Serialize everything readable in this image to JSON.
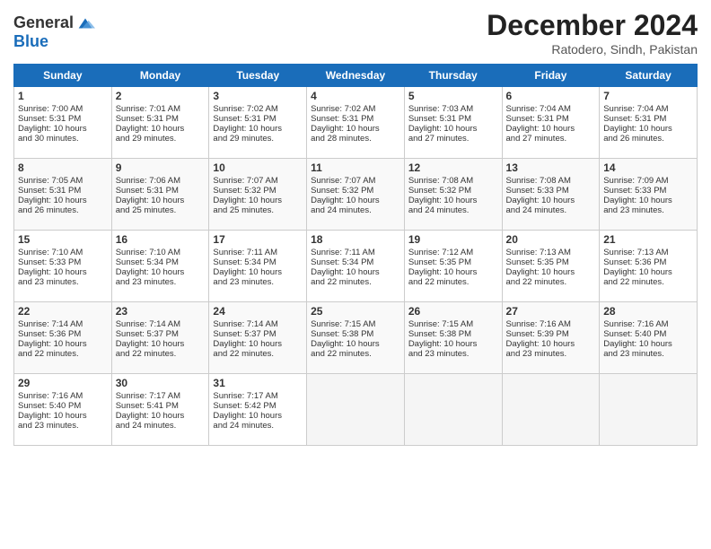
{
  "logo": {
    "line1": "General",
    "line2": "Blue"
  },
  "title": "December 2024",
  "subtitle": "Ratodero, Sindh, Pakistan",
  "days_of_week": [
    "Sunday",
    "Monday",
    "Tuesday",
    "Wednesday",
    "Thursday",
    "Friday",
    "Saturday"
  ],
  "weeks": [
    [
      {
        "day": 1,
        "lines": [
          "Sunrise: 7:00 AM",
          "Sunset: 5:31 PM",
          "Daylight: 10 hours",
          "and 30 minutes."
        ]
      },
      {
        "day": 2,
        "lines": [
          "Sunrise: 7:01 AM",
          "Sunset: 5:31 PM",
          "Daylight: 10 hours",
          "and 29 minutes."
        ]
      },
      {
        "day": 3,
        "lines": [
          "Sunrise: 7:02 AM",
          "Sunset: 5:31 PM",
          "Daylight: 10 hours",
          "and 29 minutes."
        ]
      },
      {
        "day": 4,
        "lines": [
          "Sunrise: 7:02 AM",
          "Sunset: 5:31 PM",
          "Daylight: 10 hours",
          "and 28 minutes."
        ]
      },
      {
        "day": 5,
        "lines": [
          "Sunrise: 7:03 AM",
          "Sunset: 5:31 PM",
          "Daylight: 10 hours",
          "and 27 minutes."
        ]
      },
      {
        "day": 6,
        "lines": [
          "Sunrise: 7:04 AM",
          "Sunset: 5:31 PM",
          "Daylight: 10 hours",
          "and 27 minutes."
        ]
      },
      {
        "day": 7,
        "lines": [
          "Sunrise: 7:04 AM",
          "Sunset: 5:31 PM",
          "Daylight: 10 hours",
          "and 26 minutes."
        ]
      }
    ],
    [
      {
        "day": 8,
        "lines": [
          "Sunrise: 7:05 AM",
          "Sunset: 5:31 PM",
          "Daylight: 10 hours",
          "and 26 minutes."
        ]
      },
      {
        "day": 9,
        "lines": [
          "Sunrise: 7:06 AM",
          "Sunset: 5:31 PM",
          "Daylight: 10 hours",
          "and 25 minutes."
        ]
      },
      {
        "day": 10,
        "lines": [
          "Sunrise: 7:07 AM",
          "Sunset: 5:32 PM",
          "Daylight: 10 hours",
          "and 25 minutes."
        ]
      },
      {
        "day": 11,
        "lines": [
          "Sunrise: 7:07 AM",
          "Sunset: 5:32 PM",
          "Daylight: 10 hours",
          "and 24 minutes."
        ]
      },
      {
        "day": 12,
        "lines": [
          "Sunrise: 7:08 AM",
          "Sunset: 5:32 PM",
          "Daylight: 10 hours",
          "and 24 minutes."
        ]
      },
      {
        "day": 13,
        "lines": [
          "Sunrise: 7:08 AM",
          "Sunset: 5:33 PM",
          "Daylight: 10 hours",
          "and 24 minutes."
        ]
      },
      {
        "day": 14,
        "lines": [
          "Sunrise: 7:09 AM",
          "Sunset: 5:33 PM",
          "Daylight: 10 hours",
          "and 23 minutes."
        ]
      }
    ],
    [
      {
        "day": 15,
        "lines": [
          "Sunrise: 7:10 AM",
          "Sunset: 5:33 PM",
          "Daylight: 10 hours",
          "and 23 minutes."
        ]
      },
      {
        "day": 16,
        "lines": [
          "Sunrise: 7:10 AM",
          "Sunset: 5:34 PM",
          "Daylight: 10 hours",
          "and 23 minutes."
        ]
      },
      {
        "day": 17,
        "lines": [
          "Sunrise: 7:11 AM",
          "Sunset: 5:34 PM",
          "Daylight: 10 hours",
          "and 23 minutes."
        ]
      },
      {
        "day": 18,
        "lines": [
          "Sunrise: 7:11 AM",
          "Sunset: 5:34 PM",
          "Daylight: 10 hours",
          "and 22 minutes."
        ]
      },
      {
        "day": 19,
        "lines": [
          "Sunrise: 7:12 AM",
          "Sunset: 5:35 PM",
          "Daylight: 10 hours",
          "and 22 minutes."
        ]
      },
      {
        "day": 20,
        "lines": [
          "Sunrise: 7:13 AM",
          "Sunset: 5:35 PM",
          "Daylight: 10 hours",
          "and 22 minutes."
        ]
      },
      {
        "day": 21,
        "lines": [
          "Sunrise: 7:13 AM",
          "Sunset: 5:36 PM",
          "Daylight: 10 hours",
          "and 22 minutes."
        ]
      }
    ],
    [
      {
        "day": 22,
        "lines": [
          "Sunrise: 7:14 AM",
          "Sunset: 5:36 PM",
          "Daylight: 10 hours",
          "and 22 minutes."
        ]
      },
      {
        "day": 23,
        "lines": [
          "Sunrise: 7:14 AM",
          "Sunset: 5:37 PM",
          "Daylight: 10 hours",
          "and 22 minutes."
        ]
      },
      {
        "day": 24,
        "lines": [
          "Sunrise: 7:14 AM",
          "Sunset: 5:37 PM",
          "Daylight: 10 hours",
          "and 22 minutes."
        ]
      },
      {
        "day": 25,
        "lines": [
          "Sunrise: 7:15 AM",
          "Sunset: 5:38 PM",
          "Daylight: 10 hours",
          "and 22 minutes."
        ]
      },
      {
        "day": 26,
        "lines": [
          "Sunrise: 7:15 AM",
          "Sunset: 5:38 PM",
          "Daylight: 10 hours",
          "and 23 minutes."
        ]
      },
      {
        "day": 27,
        "lines": [
          "Sunrise: 7:16 AM",
          "Sunset: 5:39 PM",
          "Daylight: 10 hours",
          "and 23 minutes."
        ]
      },
      {
        "day": 28,
        "lines": [
          "Sunrise: 7:16 AM",
          "Sunset: 5:40 PM",
          "Daylight: 10 hours",
          "and 23 minutes."
        ]
      }
    ],
    [
      {
        "day": 29,
        "lines": [
          "Sunrise: 7:16 AM",
          "Sunset: 5:40 PM",
          "Daylight: 10 hours",
          "and 23 minutes."
        ]
      },
      {
        "day": 30,
        "lines": [
          "Sunrise: 7:17 AM",
          "Sunset: 5:41 PM",
          "Daylight: 10 hours",
          "and 24 minutes."
        ]
      },
      {
        "day": 31,
        "lines": [
          "Sunrise: 7:17 AM",
          "Sunset: 5:42 PM",
          "Daylight: 10 hours",
          "and 24 minutes."
        ]
      },
      null,
      null,
      null,
      null
    ]
  ]
}
